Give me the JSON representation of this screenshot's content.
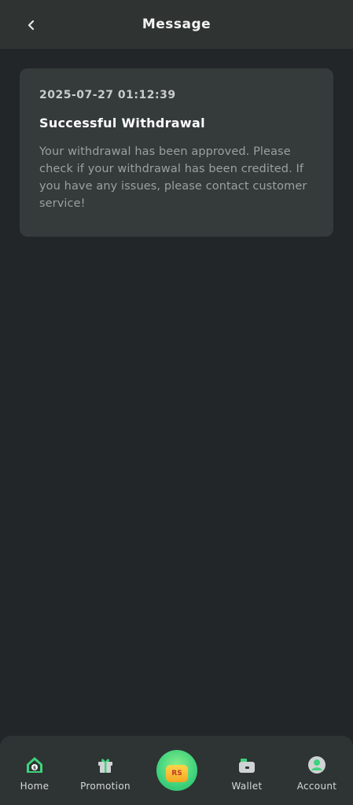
{
  "header": {
    "title": "Message"
  },
  "message": {
    "time": "2025-07-27 01:12:39",
    "title": "Successful Withdrawal",
    "body": "Your withdrawal has been approved. Please check if your withdrawal has been credited. If you have any issues, please contact customer service!"
  },
  "nav": {
    "home": "Home",
    "promotion": "Promotion",
    "center_coin": "RS",
    "wallet": "Wallet",
    "account": "Account"
  },
  "colors": {
    "accent": "#3fd27c",
    "background": "#232629",
    "card": "#353b3b"
  }
}
